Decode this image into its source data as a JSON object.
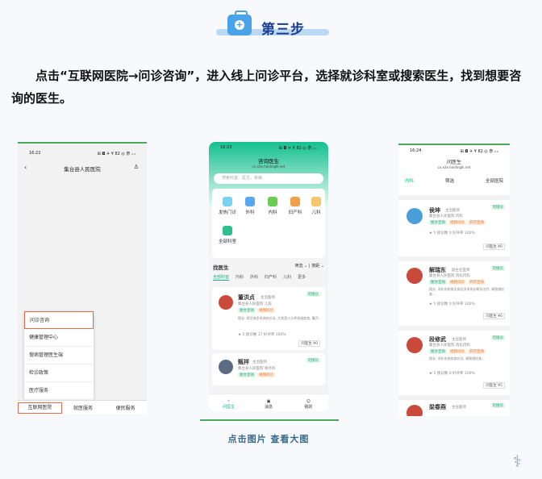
{
  "header": {
    "step_title": "第三步"
  },
  "intro": "点击“互联网医院→问诊咨询”，进入线上问诊平台，选择就诊科室或搜索医生，找到想要咨询的医生。",
  "phone1": {
    "time": "16:22",
    "signal": "⊞ ◘ ✈ ¥ 82 ◎ 奈 ᵢₗ ᵢₗ",
    "title": "集台县人民医院",
    "menu": [
      "问诊咨询",
      "健康管理中心",
      "慢病管理医生端",
      "检诊政策",
      "医疗服务"
    ],
    "tabs": [
      "互联网医院",
      "就医服务",
      "便民服务"
    ]
  },
  "phone2": {
    "time": "16:23",
    "signal": "⊞ ◘ ✈ ¥ 82 ◎ 奈 ᵢₗ ᵢₗ",
    "title": "咨询医生",
    "subtitle": "cx.e2e.holdinglk.net",
    "search_placeholder": "搜索科室、医生、疾病",
    "depts": [
      "发热门诊",
      "外科",
      "内科",
      "妇产科",
      "儿科",
      "全部科室"
    ],
    "find_title": "找医生",
    "find_controls": [
      "筛选",
      "按距"
    ],
    "tabs": [
      "全部科室",
      "内科",
      "外科",
      "妇产科",
      "儿科",
      "更多"
    ],
    "doctors": [
      {
        "name": "董洪贞",
        "title": "主治医师",
        "hospital": "集台县人民医院  儿科",
        "tags": [
          "图文咨询",
          "视频问诊"
        ],
        "badge": "可接诊",
        "desc": "擅长: 常见病多发病的诊治, 尤其是小儿呼吸道疾病, 腹泻...",
        "stats": "★ 5    接诊数 17    好评率 100%",
        "price": "问医生 ¥0"
      },
      {
        "name": "甄祥",
        "title": "主治医师",
        "hospital": "集台县人民医院  骨外科",
        "tags": [
          "图文咨询",
          "视频问诊"
        ],
        "badge": "可接诊"
      }
    ],
    "tabbar": [
      "问医生",
      "消息",
      "我的"
    ]
  },
  "phone3": {
    "time": "16:24",
    "signal": "⊞ ◘ ✈ ¥ 82 ◎ 奈 ᵢₗ ᵢₗ",
    "title": "问医生",
    "subtitle": "cx.e2e.holdinglk.net",
    "filters": [
      "内科",
      "筛选",
      "全部医院"
    ],
    "doctors": [
      {
        "name": "侯坤",
        "title": "主治医师",
        "hospital": "集台县人民医院  内科",
        "tags": [
          "图文咨询",
          "视频问诊",
          "开药咨询"
        ],
        "badge": "可接诊",
        "stats": "★ 5   接诊数 0   好评率 100%",
        "price": "问医生 ¥0"
      },
      {
        "name": "解瑞东",
        "title": "副主任医师",
        "hospital": "集台县人民医院  消化内科",
        "tags": [
          "图文咨询",
          "视频问诊",
          "开药咨询"
        ],
        "badge": "可接诊",
        "desc": "擅长: 消化系统常见病及多发病诊断及治疗, 胃肠镜检查...",
        "stats": "★ 5   接诊数 0   好评率 100%",
        "price": "问医生 ¥0"
      },
      {
        "name": "段修武",
        "title": "主任医师",
        "hospital": "集台县人民医院  消化内科",
        "tags": [
          "图文咨询",
          "视频问诊",
          "开药咨询"
        ],
        "badge": "可接诊",
        "desc": "擅长: 消化系统疾病诊治, 胃肠镜检查...",
        "stats": "★ 5   接诊数 0   好评率 100%",
        "price": "问医生 ¥5"
      },
      {
        "name": "梁春燕",
        "title": "主任医师",
        "badge": "可接诊"
      }
    ]
  },
  "caption": "点击图片 查看大图"
}
